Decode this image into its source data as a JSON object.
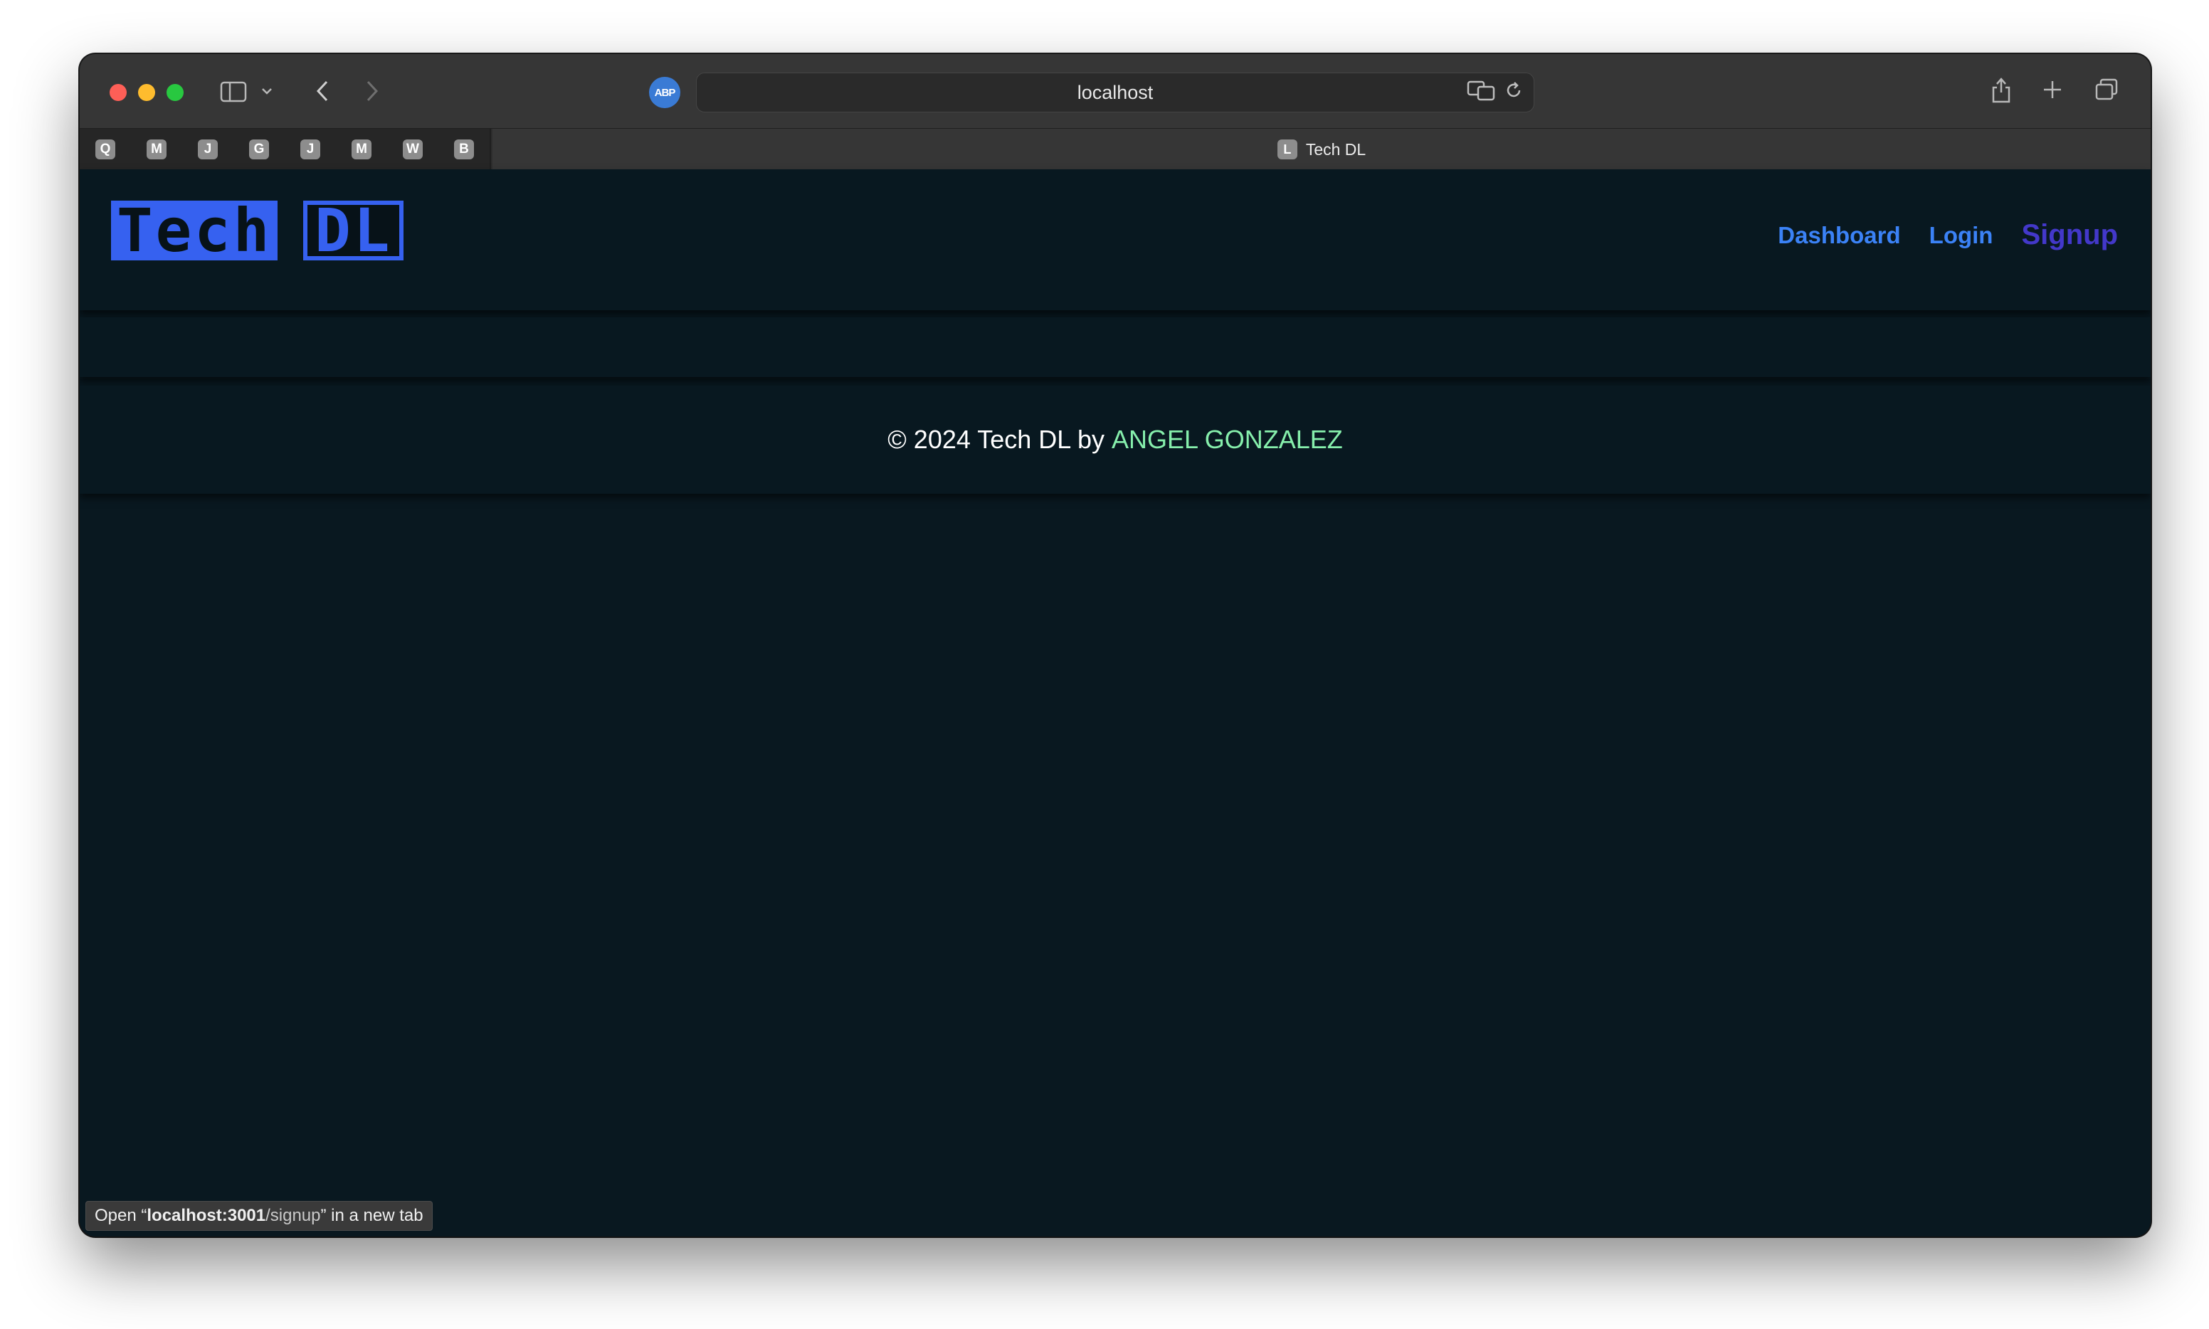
{
  "browser": {
    "url": "localhost",
    "extension_badge": "ABP",
    "pinned_tabs": [
      "Q",
      "M",
      "J",
      "G",
      "J",
      "M",
      "W",
      "B"
    ],
    "active_tab": {
      "favicon_letter": "L",
      "title": "Tech DL"
    },
    "status_text_prefix": "Open “",
    "status_text_host": "localhost:3001",
    "status_text_path": "/signup",
    "status_text_suffix": "” in a new tab"
  },
  "site": {
    "logo": {
      "word1": "Tech",
      "word2": "DL"
    },
    "nav": {
      "dashboard": "Dashboard",
      "login": "Login",
      "signup": "Signup"
    },
    "footer": {
      "text": "© 2024 Tech DL by",
      "author": "ANGEL GONZALEZ"
    }
  },
  "colors": {
    "page_bg": "#091820",
    "brand_blue": "#3661f0",
    "nav_link": "#3b82f6",
    "signup_link": "#4338ca",
    "author_green": "#86efac"
  }
}
